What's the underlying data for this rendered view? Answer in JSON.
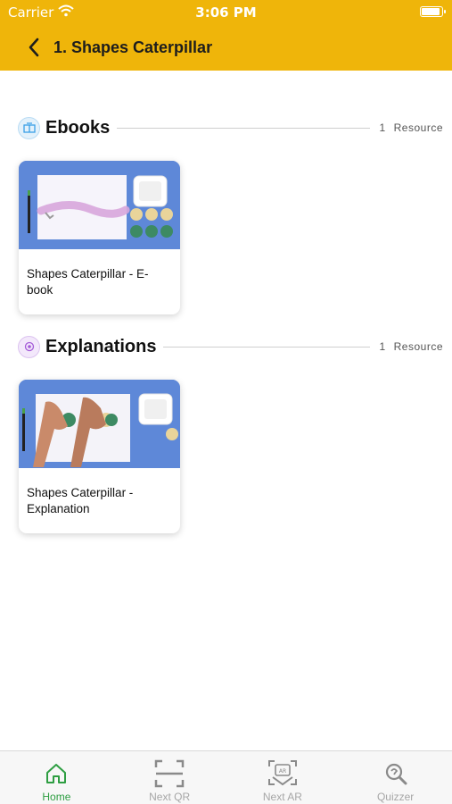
{
  "status_bar": {
    "carrier": "Carrier",
    "time": "3:06 PM"
  },
  "header": {
    "title": "1. Shapes Caterpillar",
    "background": "#EFB50A"
  },
  "sections": [
    {
      "title": "Ebooks",
      "count": "1",
      "count_label": "Resource",
      "icon": "ebook-icon",
      "cards": [
        {
          "title": "Shapes Caterpillar - E-book"
        }
      ]
    },
    {
      "title": "Explanations",
      "count": "1",
      "count_label": "Resource",
      "icon": "explanation-icon",
      "cards": [
        {
          "title": "Shapes Caterpillar - Explanation"
        }
      ]
    }
  ],
  "tabs": [
    {
      "label": "Home",
      "icon": "home-icon",
      "active": true
    },
    {
      "label": "Next QR",
      "icon": "qr-scan-icon",
      "active": false
    },
    {
      "label": "Next AR",
      "icon": "ar-icon",
      "active": false
    },
    {
      "label": "Quizzer",
      "icon": "quizzer-icon",
      "active": false
    }
  ],
  "colors": {
    "accent": "#EFB50A",
    "active_tab": "#2e9e42",
    "inactive_tab": "#a6a6a6"
  }
}
